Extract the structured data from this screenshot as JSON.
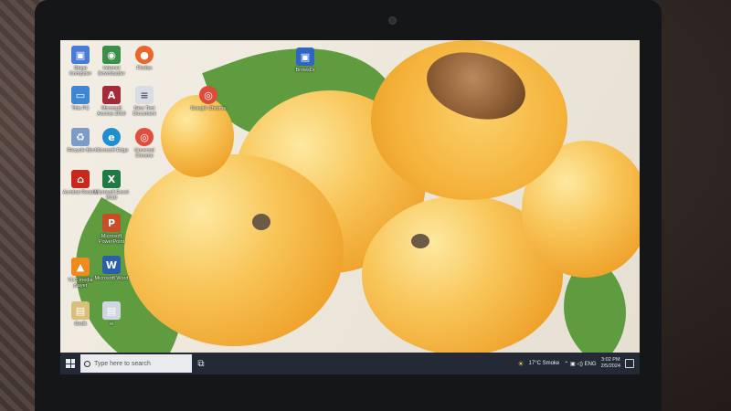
{
  "desktop": {
    "icons": [
      {
        "label": "Stage Computer",
        "icon": "computer-icon",
        "color": "#4a7bd8",
        "glyph": "▣"
      },
      {
        "label": "Internet Downloader",
        "icon": "globe-download-icon",
        "color": "#3b8f4a",
        "glyph": "◉"
      },
      {
        "label": "Firefox",
        "icon": "firefox-icon",
        "color": "#e8672a",
        "glyph": "●"
      },
      {
        "label": "This PC",
        "icon": "this-pc-icon",
        "color": "#3c86d4",
        "glyph": "▭"
      },
      {
        "label": "Microsoft Access 2010",
        "icon": "access-icon",
        "color": "#a52b37",
        "glyph": "A"
      },
      {
        "label": "New Text Document",
        "icon": "text-document-icon",
        "color": "#d8dde4",
        "glyph": "≡"
      },
      {
        "label": "Google Chrome",
        "icon": "chrome-icon",
        "color": "#dd4b39",
        "glyph": "◎"
      },
      {
        "label": "Recycle Bin",
        "icon": "recycle-bin-icon",
        "color": "#7b9cc7",
        "glyph": "♻"
      },
      {
        "label": "Microsoft Edge",
        "icon": "edge-icon",
        "color": "#1f8fd0",
        "glyph": "e"
      },
      {
        "label": "Unversal Chrome",
        "icon": "chrome-variant-icon",
        "color": "#e04e3c",
        "glyph": "◎"
      },
      {
        "label": "Acrobat Reader",
        "icon": "acrobat-icon",
        "color": "#c9281c",
        "glyph": "⌂"
      },
      {
        "label": "Microsoft Excel 2010",
        "icon": "excel-icon",
        "color": "#1f7a43",
        "glyph": "X"
      },
      {
        "label": "Microsoft PowerPoint",
        "icon": "powerpoint-icon",
        "color": "#c94d26",
        "glyph": "P"
      },
      {
        "label": "VLC media player",
        "icon": "vlc-icon",
        "color": "#ef8a1c",
        "glyph": "▲"
      },
      {
        "label": "Microsoft Word",
        "icon": "word-icon",
        "color": "#2b5fae",
        "glyph": "W"
      },
      {
        "label": "Gedit",
        "icon": "file-icon",
        "color": "#d8c07a",
        "glyph": "▤"
      },
      {
        "label": "w",
        "icon": "file-icon",
        "color": "#cfd6df",
        "glyph": "▤"
      },
      {
        "label": "BrowsDr",
        "icon": "monitor-icon",
        "color": "#2f66c4",
        "glyph": "▣"
      }
    ]
  },
  "taskbar": {
    "search_placeholder": "Type here to search",
    "taskview_glyph": "⧉",
    "weather": "17°C  Smoke",
    "tray_glyphs": "⌃  ▣  ◁)  ENG",
    "time": "3:02 PM",
    "date": "2/5/2024"
  }
}
